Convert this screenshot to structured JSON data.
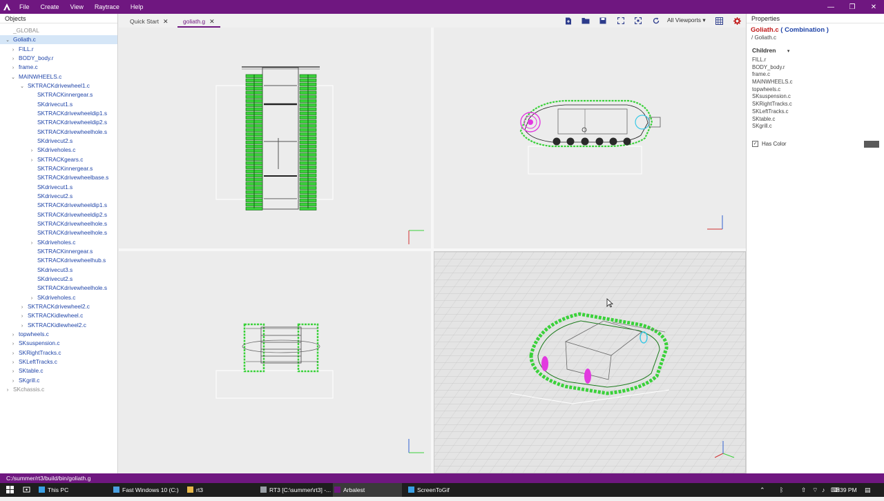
{
  "menubar": {
    "app_icon": "arbalest-icon",
    "items": [
      "File",
      "Create",
      "View",
      "Raytrace",
      "Help"
    ],
    "window_controls": [
      "—",
      "❐",
      "✕"
    ]
  },
  "objects_panel": {
    "title": "Objects",
    "tree": [
      {
        "label": "_GLOBAL",
        "level": 0,
        "dim": true,
        "arrow": ""
      },
      {
        "label": "Goliath.c",
        "level": 0,
        "arrow": "down",
        "selected": true
      },
      {
        "label": "FILL.r",
        "level": 1,
        "arrow": "right"
      },
      {
        "label": "BODY_body.r",
        "level": 1,
        "arrow": "right"
      },
      {
        "label": "frame.c",
        "level": 1,
        "arrow": "right"
      },
      {
        "label": "MAINWHEELS.c",
        "level": 1,
        "arrow": "down"
      },
      {
        "label": "SKTRACKdrivewheel1.c",
        "level": 2,
        "arrow": "down"
      },
      {
        "label": "SKTRACKinnergear.s",
        "level": 3,
        "arrow": ""
      },
      {
        "label": "SKdrivecut1.s",
        "level": 3,
        "arrow": ""
      },
      {
        "label": "SKTRACKdrivewheeldip1.s",
        "level": 3,
        "arrow": ""
      },
      {
        "label": "SKTRACKdrivewheeldip2.s",
        "level": 3,
        "arrow": ""
      },
      {
        "label": "SKTRACKdrivewheelhole.s",
        "level": 3,
        "arrow": ""
      },
      {
        "label": "SKdrivecut2.s",
        "level": 3,
        "arrow": ""
      },
      {
        "label": "SKdriveholes.c",
        "level": 3,
        "arrow": "right"
      },
      {
        "label": "SKTRACKgears.c",
        "level": 3,
        "arrow": "right"
      },
      {
        "label": "SKTRACKinnergear.s",
        "level": 3,
        "arrow": ""
      },
      {
        "label": "SKTRACKdrivewheelbase.s",
        "level": 3,
        "arrow": ""
      },
      {
        "label": "SKdrivecut1.s",
        "level": 3,
        "arrow": ""
      },
      {
        "label": "SKdrivecut2.s",
        "level": 3,
        "arrow": ""
      },
      {
        "label": "SKTRACKdrivewheeldip1.s",
        "level": 3,
        "arrow": ""
      },
      {
        "label": "SKTRACKdrivewheeldip2.s",
        "level": 3,
        "arrow": ""
      },
      {
        "label": "SKTRACKdrivewheelhole.s",
        "level": 3,
        "arrow": ""
      },
      {
        "label": "SKTRACKdrivewheelhole.s",
        "level": 3,
        "arrow": ""
      },
      {
        "label": "SKdriveholes.c",
        "level": 3,
        "arrow": "right"
      },
      {
        "label": "SKTRACKinnergear.s",
        "level": 3,
        "arrow": ""
      },
      {
        "label": "SKTRACKdrivewheelhub.s",
        "level": 3,
        "arrow": ""
      },
      {
        "label": "SKdrivecut3.s",
        "level": 3,
        "arrow": ""
      },
      {
        "label": "SKdrivecut2.s",
        "level": 3,
        "arrow": ""
      },
      {
        "label": "SKTRACKdrivewheelhole.s",
        "level": 3,
        "arrow": ""
      },
      {
        "label": "SKdriveholes.c",
        "level": 3,
        "arrow": "right"
      },
      {
        "label": "SKTRACKdrivewheel2.c",
        "level": 2,
        "arrow": "right"
      },
      {
        "label": "SKTRACKidlewheel.c",
        "level": 2,
        "arrow": "right"
      },
      {
        "label": "SKTRACKidlewheel2.c",
        "level": 2,
        "arrow": "right"
      },
      {
        "label": "topwheels.c",
        "level": 1,
        "arrow": "right"
      },
      {
        "label": "SKsuspension.c",
        "level": 1,
        "arrow": "right"
      },
      {
        "label": "SKRightTracks.c",
        "level": 1,
        "arrow": "right"
      },
      {
        "label": "SKLeftTracks.c",
        "level": 1,
        "arrow": "right"
      },
      {
        "label": "SKtable.c",
        "level": 1,
        "arrow": "right"
      },
      {
        "label": "SKgrill.c",
        "level": 1,
        "arrow": "right"
      },
      {
        "label": "SKchassis.c",
        "level": 0,
        "dim": true,
        "arrow": "right"
      }
    ]
  },
  "tabs": [
    {
      "label": "Quick Start",
      "close": "✕",
      "active": false
    },
    {
      "label": "goliath.g",
      "close": "✕",
      "active": true
    }
  ],
  "toolbar": {
    "icons": [
      "new-file-icon",
      "open-folder-icon",
      "save-icon",
      "fit-screen-icon",
      "fit-selection-icon",
      "reset-view-icon"
    ],
    "viewport_select": "All Viewports ▾",
    "grid_icon": "grid-icon",
    "settings_icon": "gear-icon"
  },
  "properties": {
    "title": "Properties",
    "object_name": "Goliath.c",
    "object_type": "( Combination )",
    "path": "/ Goliath.c",
    "children_label": "Children",
    "children_chevron": "▾",
    "children": [
      "FILL.r",
      "BODY_body.r",
      "frame.c",
      "MAINWHEELS.c",
      "topwheels.c",
      "SKsuspension.c",
      "SKRightTracks.c",
      "SKLeftTracks.c",
      "SKtable.c",
      "SKgrill.c"
    ],
    "has_color_label": "Has Color",
    "has_color_checked": "✓",
    "color": "#5a5a5a"
  },
  "statusbar": {
    "path": "C:/summer/rt3/build/bin/goliath.g"
  },
  "taskbar": {
    "start_icon": "windows-start-icon",
    "search_icon": "search-icon",
    "tasks": [
      {
        "label": "This PC",
        "icon": "computer-icon",
        "color": "#3aa0e6",
        "active": false
      },
      {
        "label": "Fast Windows 10 (C:)",
        "icon": "folder-icon",
        "color": "#4a9fe0",
        "active": false
      },
      {
        "label": "rt3",
        "icon": "folder-icon",
        "color": "#e8b84a",
        "active": false
      },
      {
        "label": "RT3 [C:\\summer\\rt3] -...",
        "icon": "ide-icon",
        "color": "#9aa0a6",
        "active": false
      },
      {
        "label": "Arbalest",
        "icon": "arbalest-icon",
        "color": "#6f1780",
        "active": true
      },
      {
        "label": "ScreenToGif",
        "icon": "screen-record-icon",
        "color": "#3aa0e6",
        "active": false
      }
    ],
    "tray_icons": [
      "chevron-up-icon",
      "bluetooth-icon",
      "up-arrow-icon",
      "wifi-icon",
      "volume-icon",
      "language-icon"
    ],
    "time": "1:39 PM",
    "notification_icon": "notification-icon"
  },
  "colors": {
    "accent": "#6f1780",
    "track_green": "#3ad13a",
    "selection_red": "#c01818",
    "link_blue": "#1f44a8"
  }
}
